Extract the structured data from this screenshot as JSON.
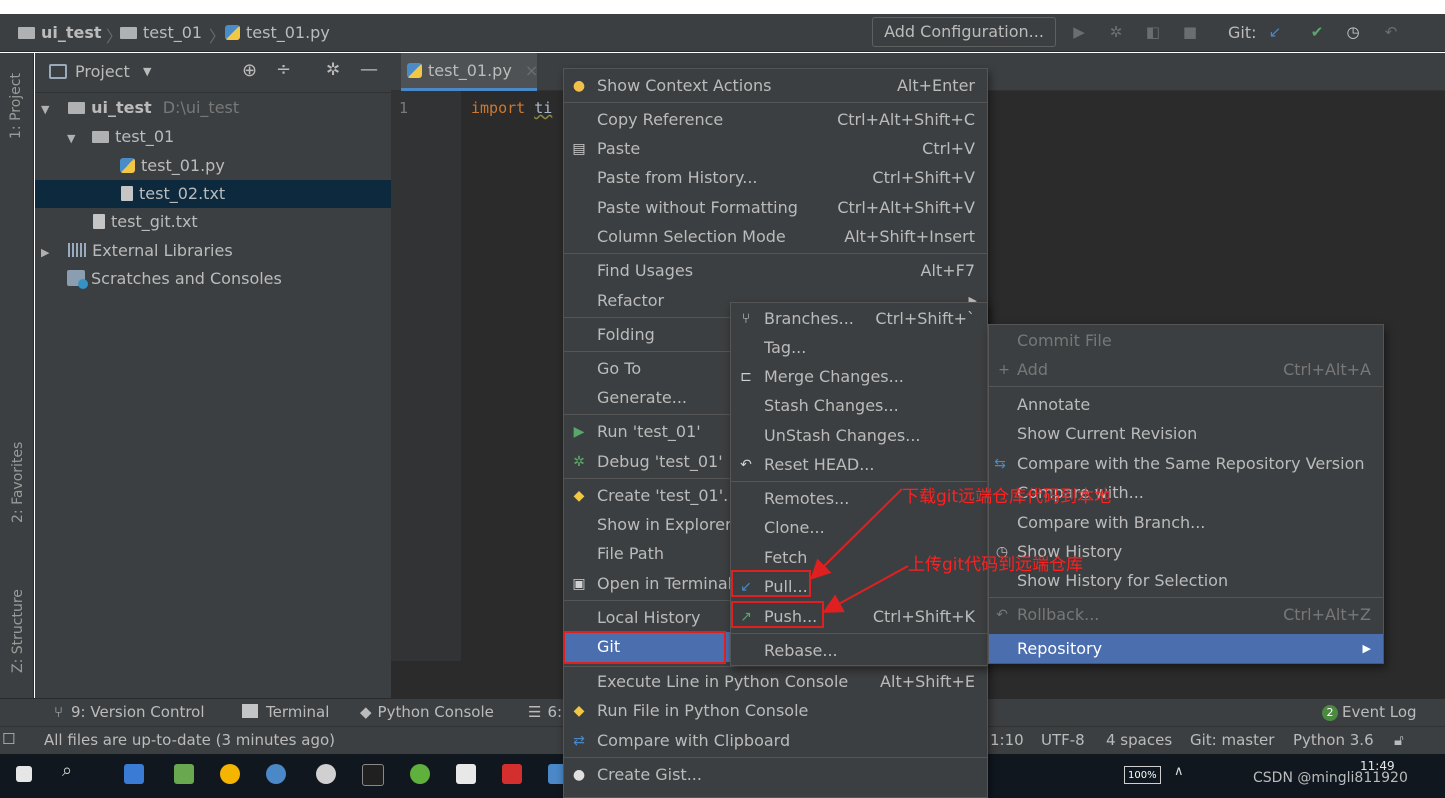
{
  "navbar": {
    "project": "ui_test",
    "folder": "test_01",
    "file": "test_01.py",
    "add_configuration": "Add Configuration...",
    "git_label": "Git:"
  },
  "left_stripe": {
    "project_tab": "1: Project",
    "favorites_tab": "2: Favorites",
    "structure_tab": "Z: Structure"
  },
  "project_panel": {
    "title": "Project",
    "tree": [
      {
        "label": "ui_test",
        "hint": "D:\\ui_test",
        "type": "folder",
        "expanded": true
      },
      {
        "label": "test_01",
        "type": "folder",
        "expanded": true
      },
      {
        "label": "test_01.py",
        "type": "python"
      },
      {
        "label": "test_02.txt",
        "type": "text",
        "selected": true
      },
      {
        "label": "test_git.txt",
        "type": "text"
      },
      {
        "label": "External Libraries",
        "type": "library",
        "expanded": false
      },
      {
        "label": "Scratches and Consoles",
        "type": "scratch"
      }
    ]
  },
  "editor": {
    "tab_label": "test_01.py",
    "line_number": "1",
    "code_keyword": "import",
    "code_rest": "ti"
  },
  "context_menu": {
    "items": [
      {
        "label": "Show Context Actions",
        "shortcut": "Alt+Enter",
        "icon": "bulb-icon"
      },
      {
        "label": "Copy Reference",
        "shortcut": "Ctrl+Alt+Shift+C"
      },
      {
        "label": "Paste",
        "shortcut": "Ctrl+V",
        "icon": "clipboard-icon"
      },
      {
        "label": "Paste from History...",
        "shortcut": "Ctrl+Shift+V"
      },
      {
        "label": "Paste without Formatting",
        "shortcut": "Ctrl+Alt+Shift+V"
      },
      {
        "label": "Column Selection Mode",
        "shortcut": "Alt+Shift+Insert"
      },
      {
        "label": "Find Usages",
        "shortcut": "Alt+F7"
      },
      {
        "label": "Refactor",
        "shortcut": ""
      },
      {
        "label": "Folding",
        "shortcut": ""
      },
      {
        "label": "Go To",
        "shortcut": ""
      },
      {
        "label": "Generate...",
        "shortcut": ""
      },
      {
        "label": "Run 'test_01'",
        "shortcut": "",
        "icon": "run-icon"
      },
      {
        "label": "Debug 'test_01'",
        "shortcut": "",
        "icon": "debug-icon"
      },
      {
        "label": "Create 'test_01'...",
        "shortcut": "",
        "icon": "python-icon"
      },
      {
        "label": "Show in Explorer",
        "shortcut": ""
      },
      {
        "label": "File Path",
        "shortcut": ""
      },
      {
        "label": "Open in Terminal",
        "shortcut": "",
        "icon": "terminal-icon"
      },
      {
        "label": "Local History",
        "shortcut": ""
      },
      {
        "label": "Git",
        "shortcut": ""
      },
      {
        "label": "Execute Line in Python Console",
        "shortcut": "Alt+Shift+E"
      },
      {
        "label": "Run File in Python Console",
        "shortcut": "",
        "icon": "python-icon"
      },
      {
        "label": "Compare with Clipboard",
        "shortcut": "",
        "icon": "compare-icon"
      },
      {
        "label": "Create Gist...",
        "shortcut": "",
        "icon": "github-icon"
      }
    ]
  },
  "git_submenu": {
    "items": [
      {
        "label": "Branches...",
        "shortcut": "Ctrl+Shift+`",
        "icon": "branch-icon"
      },
      {
        "label": "Tag...",
        "shortcut": ""
      },
      {
        "label": "Merge Changes...",
        "shortcut": "",
        "icon": "merge-icon"
      },
      {
        "label": "Stash Changes...",
        "shortcut": ""
      },
      {
        "label": "UnStash Changes...",
        "shortcut": ""
      },
      {
        "label": "Reset HEAD...",
        "shortcut": "",
        "icon": "reset-icon"
      },
      {
        "label": "Remotes...",
        "shortcut": ""
      },
      {
        "label": "Clone...",
        "shortcut": ""
      },
      {
        "label": "Fetch",
        "shortcut": ""
      },
      {
        "label": "Pull...",
        "shortcut": "",
        "icon": "pull-icon"
      },
      {
        "label": "Push...",
        "shortcut": "Ctrl+Shift+K",
        "icon": "push-icon"
      },
      {
        "label": "Rebase...",
        "shortcut": ""
      }
    ]
  },
  "repo_submenu": {
    "items": [
      {
        "label": "Commit File",
        "shortcut": "",
        "disabled": true
      },
      {
        "label": "Add",
        "shortcut": "Ctrl+Alt+A",
        "disabled": true,
        "icon": "plus-icon"
      },
      {
        "label": "Annotate",
        "shortcut": ""
      },
      {
        "label": "Show Current Revision",
        "shortcut": ""
      },
      {
        "label": "Compare with the Same Repository Version",
        "shortcut": "",
        "icon": "compare-arrows-icon"
      },
      {
        "label": "Compare with...",
        "shortcut": ""
      },
      {
        "label": "Compare with Branch...",
        "shortcut": ""
      },
      {
        "label": "Show History",
        "shortcut": "",
        "icon": "clock-icon"
      },
      {
        "label": "Show History for Selection",
        "shortcut": ""
      },
      {
        "label": "Rollback...",
        "shortcut": "Ctrl+Alt+Z",
        "disabled": true,
        "icon": "undo-icon"
      },
      {
        "label": "Repository",
        "shortcut": ""
      }
    ]
  },
  "annotations": {
    "pull_note": "下载git远端仓库代码到本地",
    "push_note": "上传git代码到远端仓库"
  },
  "bottom_tools": {
    "version_control": "9: Version Control",
    "terminal": "Terminal",
    "python_console": "Python Console",
    "todo": "6:",
    "event_log": "Event Log",
    "event_count": "2"
  },
  "status_bar": {
    "message": "All files are up-to-date (3 minutes ago)",
    "position": "1:10",
    "encoding": "UTF-8",
    "indent": "4 spaces",
    "git_branch": "Git: master",
    "interpreter": "Python 3.6"
  },
  "taskbar": {
    "battery": "100%",
    "time": "11:49",
    "watermark": "CSDN @mingli811920"
  },
  "colors": {
    "ide_bg": "#3c3f41",
    "editor_bg": "#2b2b2b",
    "highlight": "#4b6eaf",
    "annotation": "#e02020"
  }
}
